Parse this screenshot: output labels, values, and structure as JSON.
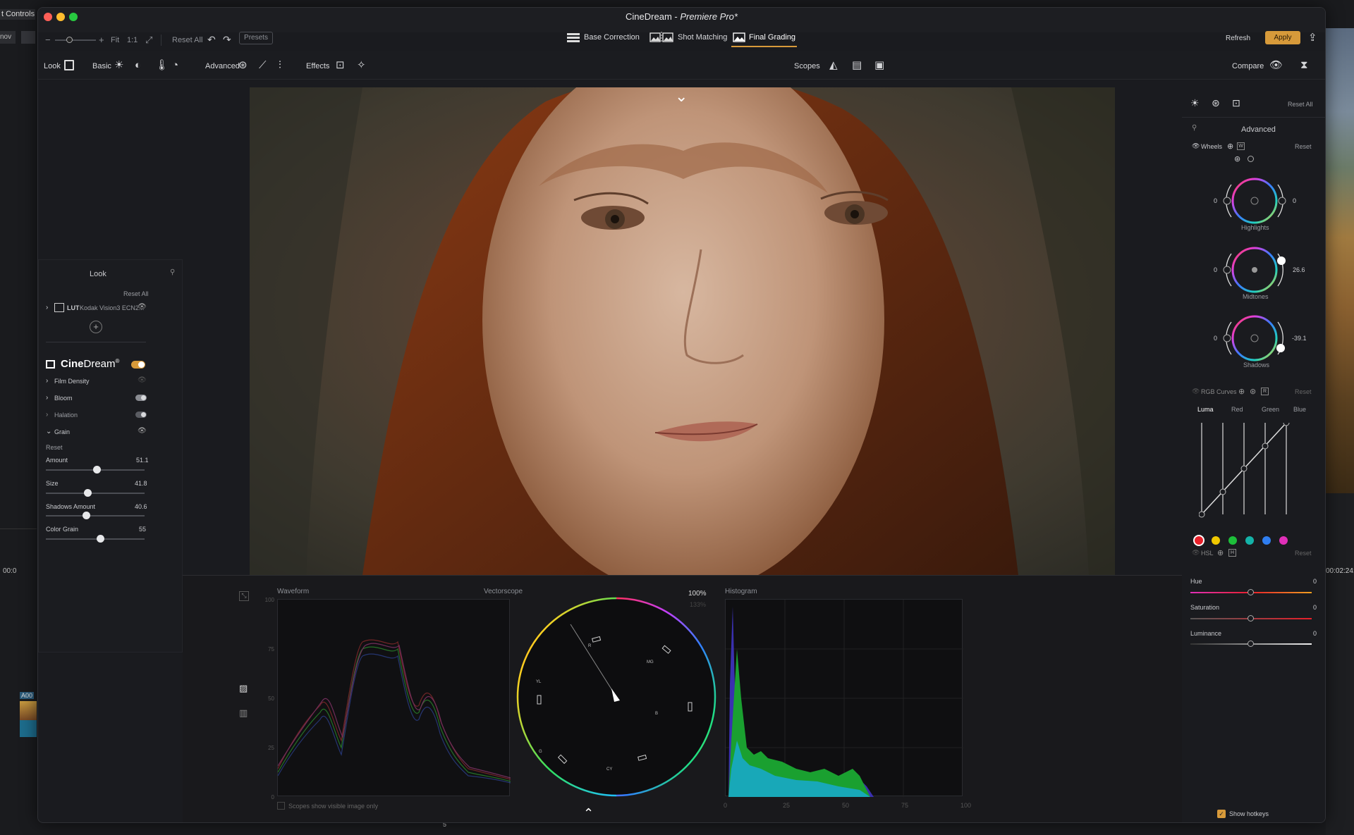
{
  "bg": {
    "controls_tab": "t Controls",
    "mov": "nov",
    "clip": "A00",
    "timecode_left": "00:0",
    "timecode_right": "00:02:24:",
    "marker": "5"
  },
  "window": {
    "title_app": "CineDream - ",
    "title_host": "Premiere Pro*"
  },
  "toolbar": {
    "fit": "Fit",
    "one_to_one": "1:1",
    "reset_all": "Reset All",
    "presets": "Presets",
    "refresh": "Refresh",
    "apply": "Apply",
    "modes": [
      {
        "label": "Base Correction"
      },
      {
        "label": "Shot Matching"
      },
      {
        "label": "Final Grading"
      }
    ]
  },
  "toolbar2": {
    "look": "Look",
    "basic": "Basic",
    "advanced": "Advanced",
    "effects": "Effects",
    "scopes": "Scopes",
    "compare": "Compare"
  },
  "look_panel": {
    "title": "Look",
    "reset_all": "Reset All",
    "lut_tag": "LUT",
    "lut_name": "Kodak Vision3 ECN2...",
    "brand_a": "Cine",
    "brand_b": "Dream",
    "reg": "®",
    "sections": [
      "Film Density",
      "Bloom",
      "Halation",
      "Grain"
    ],
    "reset": "Reset",
    "sliders": [
      {
        "label": "Amount",
        "value": "51.1",
        "fraction": 0.511
      },
      {
        "label": "Size",
        "value": "41.8",
        "fraction": 0.418
      },
      {
        "label": "Shadows Amount",
        "value": "40.6",
        "fraction": 0.406
      },
      {
        "label": "Color Grain",
        "value": "55",
        "fraction": 0.55
      }
    ]
  },
  "right_panel": {
    "reset_all": "Reset All",
    "advanced": "Advanced",
    "wheels": "Wheels",
    "wheels_badge": "W",
    "reset": "Reset",
    "highlights": {
      "label": "Highlights",
      "left": "0",
      "right": "0"
    },
    "midtones": {
      "label": "Midtones",
      "left": "0",
      "right": "26.6"
    },
    "shadows": {
      "label": "Shadows",
      "left": "0",
      "right": "-39.1"
    },
    "rgb_curves": "RGB Curves",
    "curves_badge": "R",
    "curve_tabs": [
      "Luma",
      "Red",
      "Green",
      "Blue"
    ],
    "hsl": "HSL",
    "hsl_badge": "H",
    "colors": [
      "#e8202a",
      "#f0c800",
      "#1dbf3a",
      "#14b3a8",
      "#2f7ef0",
      "#e02fb8"
    ],
    "hue": "Hue",
    "hue_val": "0",
    "saturation": "Saturation",
    "sat_val": "0",
    "luminance": "Luminance",
    "lum_val": "0",
    "show_hotkeys": "Show hotkeys"
  },
  "scopes": {
    "waveform": "Waveform",
    "vectorscope": "Vectorscope",
    "histogram": "Histogram",
    "zoom1": "100%",
    "zoom2": "133%",
    "wf_ticks": [
      "100",
      "75",
      "50",
      "25",
      "0"
    ],
    "hist_ticks": [
      "0",
      "25",
      "50",
      "75",
      "100"
    ],
    "show_visible": "Scopes show visible image only",
    "vec_labels": [
      "R",
      "MG",
      "B",
      "CY",
      "G",
      "YL"
    ]
  }
}
